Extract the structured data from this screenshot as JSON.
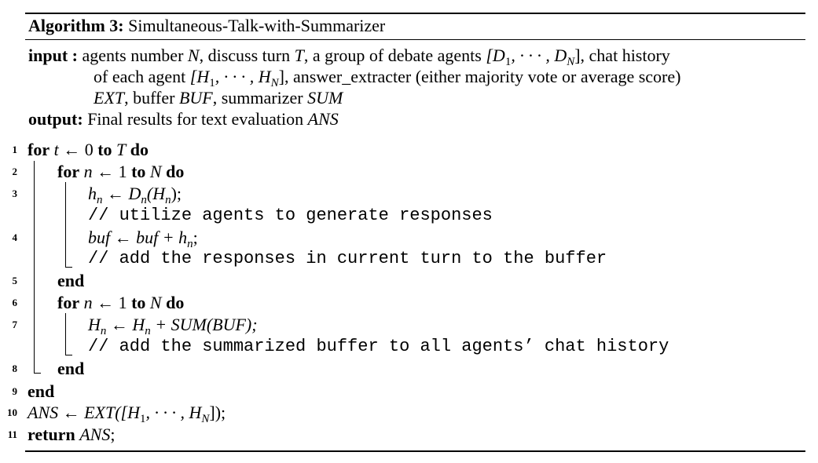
{
  "caption": {
    "label": "Algorithm 3:",
    "title": "Simultaneous-Talk-with-Summarizer"
  },
  "io": {
    "input_label": "input",
    "input_sep": " :",
    "input_line1_a": " agents number ",
    "input_line1_N": "N",
    "input_line1_b": ", discuss turn ",
    "input_line1_T": "T",
    "input_line1_c": ", a group of debate agents ",
    "input_line1_D": "[D",
    "input_line1_D_sub1": "1",
    "input_line1_D_mid": ", · · · , D",
    "input_line1_D_subN": "N",
    "input_line1_D_end": "]",
    "input_line1_d": ", chat history",
    "input_line2_a": "of each agent ",
    "input_line2_H": "[H",
    "input_line2_H_sub1": "1",
    "input_line2_H_mid": ", · · · , H",
    "input_line2_H_subN": "N",
    "input_line2_H_end": "]",
    "input_line2_b": ", answer_extracter (either majority vote or average score)",
    "input_line3_EXT": "EXT",
    "input_line3_a": ", buffer ",
    "input_line3_BUF": "BUF",
    "input_line3_b": ", summarizer ",
    "input_line3_SUM": "SUM",
    "output_label": "output:",
    "output_text": " Final results for text evaluation ",
    "output_ANS": "ANS"
  },
  "lines": {
    "n1": "1",
    "n2": "2",
    "n3": "3",
    "n4": "4",
    "n5": "5",
    "n6": "6",
    "n7": "7",
    "n8": "8",
    "n9": "9",
    "n10": "10",
    "n11": "11",
    "for": "for",
    "to": "to",
    "do": "do",
    "end": "end",
    "return": "return",
    "l1_t": "t",
    "l1_arrow": " ← 0 ",
    "l1_T": "T",
    "l2_n": "n",
    "l2_arrow": " ← 1 ",
    "l2_N": "N",
    "l3_h": "h",
    "l3_sub": "n",
    "l3_mid": " ← D",
    "l3_sub2": "n",
    "l3_par": "(H",
    "l3_sub3": "n",
    "l3_end": ");",
    "c1": "// utilize agents to generate responses",
    "l4_buf": "buf",
    "l4_mid": " ← buf + h",
    "l4_sub": "n",
    "l4_end": ";",
    "c2": "// add the responses in current turn to the buffer",
    "l6_n": "n",
    "l6_arrow": " ← 1 ",
    "l6_N": "N",
    "l7_H": "H",
    "l7_sub": "n",
    "l7_mid": " ← H",
    "l7_sub2": "n",
    "l7_end": " + SUM(BUF);",
    "c3": "// add the summarized buffer to all agents’ chat history",
    "l10_a": "ANS ← EXT([H",
    "l10_sub1": "1",
    "l10_mid": ", · · · , H",
    "l10_subN": "N",
    "l10_end": "]);",
    "l11_ANS": "ANS",
    "l11_end": ";"
  }
}
